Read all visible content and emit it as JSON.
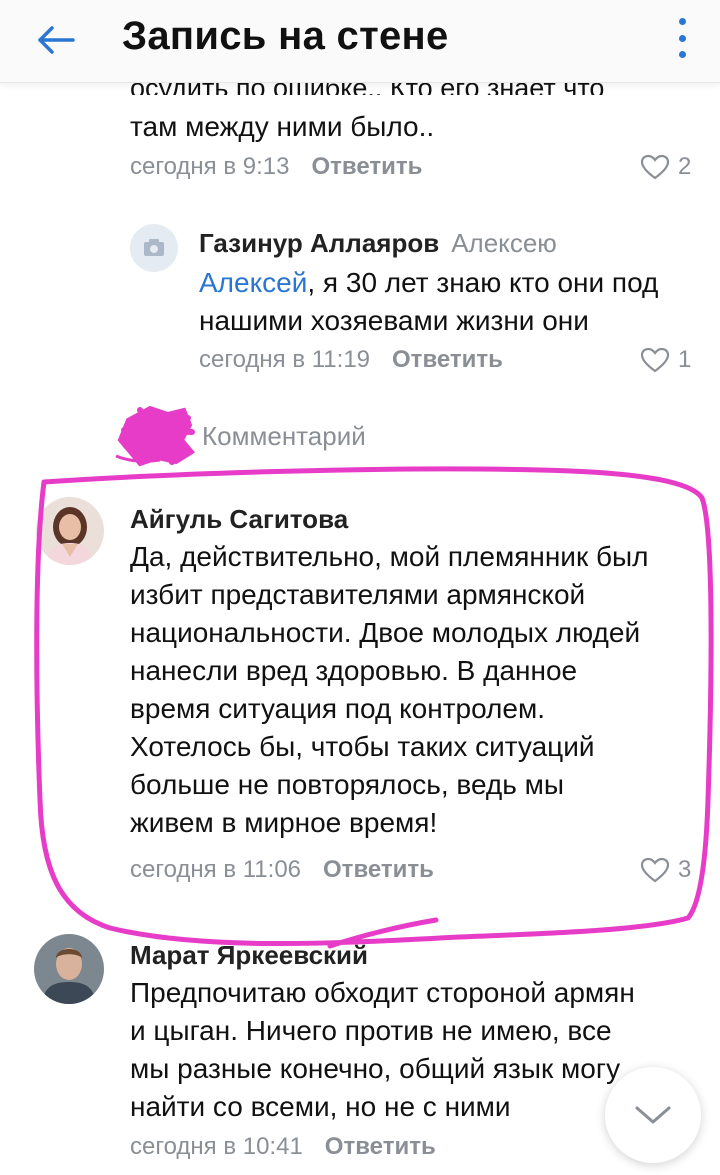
{
  "header": {
    "title": "Запись на стене"
  },
  "comments": [
    {
      "cut_text": "осудить по ошибке.. Кто его знает что",
      "text_lines": [
        "там между ними было.."
      ],
      "time": "сегодня в 9:13",
      "reply_label": "Ответить",
      "likes": "2"
    },
    {
      "author": "Газинур Аллаяров",
      "reply_to": "Алексею",
      "mention": "Алексей",
      "text_line1_rest": ", я 30 лет знаю кто они под",
      "text_line2": "нашими хозяевами жизни они",
      "time": "сегодня в 11:19",
      "reply_label": "Ответить",
      "likes": "1"
    },
    {
      "hidden_label": "Комментарий"
    },
    {
      "author": "Айгуль Сагитова",
      "text_lines": [
        "Да, действительно, мой племянник был",
        "избит представителями армянской",
        "национальности. Двое молодых людей",
        "нанесли вред здоровью. В данное",
        "время ситуация под контролем.",
        "Хотелось бы, чтобы таких ситуаций",
        "больше не повторялось, ведь мы",
        "живем в мирное время!"
      ],
      "time": "сегодня в 11:06",
      "reply_label": "Ответить",
      "likes": "3"
    },
    {
      "author": "Марат Яркеевский",
      "text_lines": [
        "Предпочитаю обходит стороной армян",
        "и цыган. Ничего против не имею, все",
        "мы разные конечно, общий язык могу",
        "найти со всеми, но не с ними"
      ],
      "time": "сегодня в 10:41",
      "reply_label": "Ответить"
    }
  ],
  "colors": {
    "link": "#2a76d2",
    "meta": "#8a8f96",
    "annotation": "#e63cc8"
  }
}
